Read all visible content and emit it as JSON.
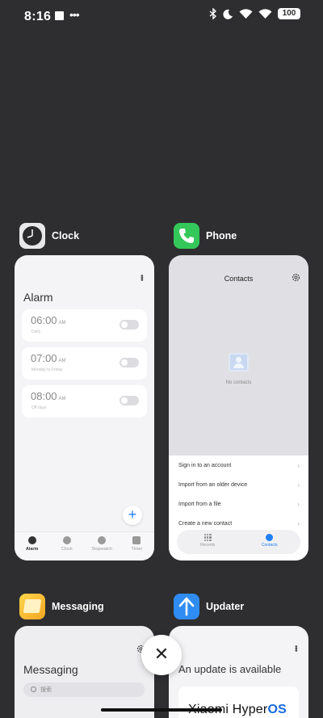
{
  "status_bar": {
    "time": "8:16",
    "dots": "•••",
    "battery": "100"
  },
  "apps": {
    "clock": {
      "name": "Clock",
      "title": "Alarm",
      "alarms": [
        {
          "time": "06:00",
          "ampm": "AM",
          "sub": "Daily",
          "enabled": false
        },
        {
          "time": "07:00",
          "ampm": "AM",
          "sub": "Monday to Friday",
          "enabled": false
        },
        {
          "time": "08:00",
          "ampm": "AM",
          "sub": "Off days",
          "enabled": false
        }
      ],
      "add_label": "+",
      "tabs": [
        {
          "label": "Alarm",
          "active": true
        },
        {
          "label": "Clock",
          "active": false
        },
        {
          "label": "Stopwatch",
          "active": false
        },
        {
          "label": "Timer",
          "active": false
        }
      ]
    },
    "phone": {
      "name": "Phone",
      "title": "Contacts",
      "empty_text": "No contacts",
      "options": [
        "Sign in to an account",
        "Import from an older device",
        "Import from a file",
        "Create a new contact"
      ],
      "tabs": [
        {
          "label": "Recents",
          "active": false
        },
        {
          "label": "Contacts",
          "active": true
        }
      ]
    },
    "messaging": {
      "name": "Messaging",
      "title": "Messaging",
      "search_placeholder": "搜索"
    },
    "updater": {
      "name": "Updater",
      "title": "An update is available",
      "brand_part1": "Xiaomi Hyper",
      "brand_part2": "OS"
    }
  },
  "close_label": "✕",
  "colors": {
    "background": "#2e2e30",
    "accent": "#1f7ff5",
    "phone_icon": "#34c759",
    "messaging_icon": "#f5b731",
    "updater_icon": "#2f8cf3"
  }
}
